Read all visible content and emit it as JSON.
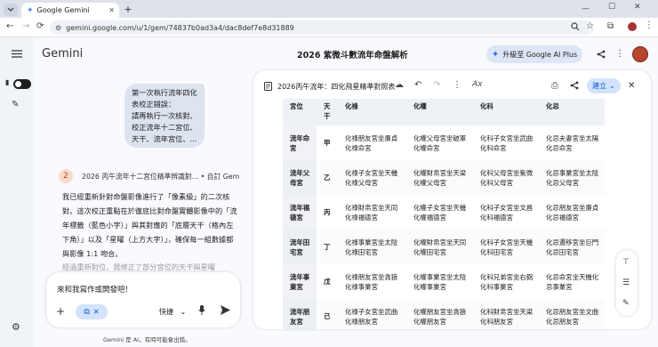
{
  "browser": {
    "tab_title": "Google Gemini",
    "url": "gemini.google.com/u/1/gem/74837b0ad3a4/dac8def7e8d31889"
  },
  "app": {
    "name": "Gemini",
    "conversation_title": "2026 紫微斗數流年命盤解析",
    "upgrade_label": "升級至 Google AI Plus"
  },
  "chat": {
    "user_message": "第一次執行流年四化\n表校正錯誤：\n請再執行一次核對、\n校正流年十二宮位、\n天干、流年宮位、...",
    "step_number": "2",
    "step_title": "2026 丙午流年十二宮位精準辨識對... • 自訂 Gem",
    "answer": "我已經重新針對命盤影像進行了「像素級」的二次核對。這次校正重點在於徹底比對命盤實體影像中的「流年標籤（藍色小字）」與其對應的「底層天干（格內左下角）」以及「星曜（上方大字）」，確保每一組數據都與影像 1:1 吻合。",
    "answer_faded": "經過重新對位，我修正了部分宮位的天干與星曜",
    "input_text": "來和我寫作或開發吧！",
    "mode_label": "快捷",
    "disclaimer": "Gemini 是 AI，有時可能會出錯。"
  },
  "canvas": {
    "title": "2026丙午流年：四化飛星精準對照表",
    "create_label": "建立",
    "columns": [
      "宮位",
      "天干",
      "化祿",
      "化權",
      "化科",
      "化忌"
    ],
    "rows": [
      [
        "流年命宮",
        "甲",
        "化祿朋友宮坐廉貞化祿命宮",
        "化權父母宮坐破軍化權命宮",
        "化科子女宮坐武曲化科命宮",
        "化忌夫妻宮坐太陽化忌命宮"
      ],
      [
        "流年父母宮",
        "乙",
        "化祿子女宮坐天機化祿父母宮",
        "化權財帛宮坐天梁化權父母宮",
        "化科父母宮坐紫微化科父母宮",
        "化忌事業宮坐太陰化忌父母宮"
      ],
      [
        "流年福德宮",
        "丙",
        "化祿財帛宮坐天同化祿福德宮",
        "化權子女宮坐天機化權福德宮",
        "化科子女宮坐文昌化科福德宮",
        "化忌朋友宮坐廉貞化忌福德宮"
      ],
      [
        "流年田宅宮",
        "丁",
        "化祿事業宮坐太陰化祿田宅宮",
        "化權財帛宮坐天同化權田宅宮",
        "化科子女宮坐天機化科田宅宮",
        "化忌遷移宮坐巨門化忌田宅宮"
      ],
      [
        "流年事業宮",
        "戊",
        "化祿朋友宮坐貪狼化祿事業宮",
        "化權事業宮坐太陰化權事業宮",
        "化科兄弟宮坐右弼化科事業宮",
        "化忌命宮坐天機化忌事業宮"
      ],
      [
        "流年朋友宮",
        "己",
        "化祿子女宮坐武曲化祿朋友宮",
        "化權朋友宮坐貪狼化權朋友宮",
        "化科財帛宮坐天梁化科朋友宮",
        "化忌朋友宮坐文曲化忌朋友宮"
      ]
    ]
  }
}
